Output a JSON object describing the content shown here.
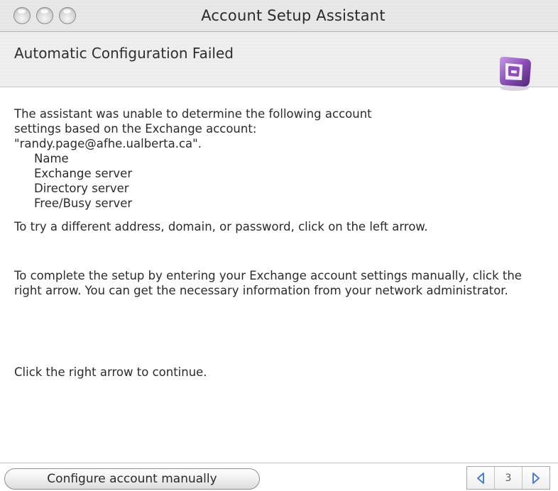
{
  "window": {
    "title": "Account Setup Assistant"
  },
  "header": {
    "title": "Automatic Configuration Failed",
    "icon": "entourage-app-icon"
  },
  "content": {
    "intro_line1": "The assistant was unable to determine the following account",
    "intro_line2": "settings based on the Exchange account:",
    "intro_line3": "\"randy.page@afhe.ualberta.ca\".",
    "settings": [
      "Name",
      "Exchange server",
      "Directory server",
      "Free/Busy server"
    ],
    "retry_text": "To try a different address, domain, or password, click on the left arrow.",
    "manual_text": "To complete the setup by entering your Exchange account settings manually, click the right arrow. You can get the necessary information from your network administrator.",
    "continue_text": "Click the right arrow to continue."
  },
  "footer": {
    "manual_button_label": "Configure account manually",
    "page_number": "3",
    "prev_icon": "left-arrow-icon",
    "next_icon": "right-arrow-icon"
  },
  "colors": {
    "arrow_blue": "#4a7fd0",
    "icon_purple": "#7a4a9e"
  }
}
